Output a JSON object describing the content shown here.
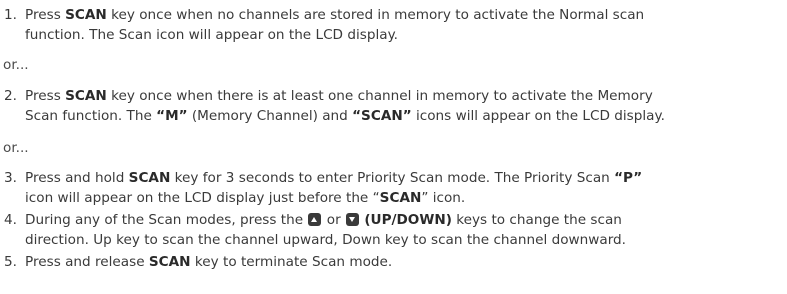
{
  "steps": [
    {
      "num": "1.",
      "lines": [
        [
          "Press ",
          "SCAN",
          " key once when no channels are stored in memory to activate the Normal scan"
        ],
        [
          "function. The Scan icon will appear on the LCD display."
        ]
      ]
    },
    {
      "num": "2.",
      "lines": [
        [
          "Press ",
          "SCAN",
          " key once when there is at least one channel in memory to activate the Memory"
        ],
        [
          "Scan function. The ",
          "“M”",
          " (Memory Channel) and ",
          "“SCAN”",
          " icons will appear on the LCD display."
        ]
      ]
    },
    {
      "num": "3.",
      "lines": [
        [
          "Press and hold ",
          "SCAN",
          " key for 3 seconds to enter Priority Scan mode. The Priority Scan ",
          "“P”"
        ],
        [
          "icon will appear on the LCD display just before the “",
          "SCAN",
          "” icon."
        ]
      ]
    },
    {
      "num": "4.",
      "lines": [
        [
          "During any of the Scan modes, press the ",
          " or ",
          " ",
          "(UP/DOWN)",
          " keys to change the scan"
        ],
        [
          "direction. Up key to scan the channel upward, Down key to scan the channel downward."
        ]
      ]
    },
    {
      "num": "5.",
      "lines": [
        [
          "Press and release ",
          "SCAN",
          " key to terminate Scan mode."
        ]
      ]
    }
  ],
  "separator": "or...",
  "icons": {
    "up_key": "up-arrow-key-icon",
    "down_key": "down-arrow-key-icon"
  }
}
